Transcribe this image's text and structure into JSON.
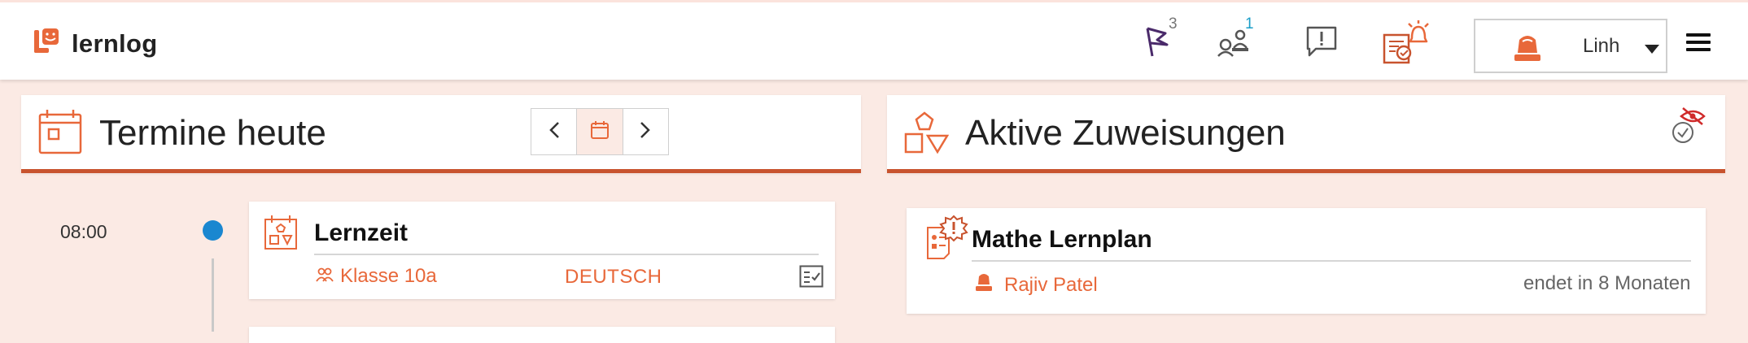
{
  "app": {
    "name": "lernlog"
  },
  "header": {
    "flag_badge": "3",
    "support_badge": "1",
    "user_name": "Linh"
  },
  "schedule": {
    "title": "Termine heute",
    "entries": [
      {
        "time": "08:00",
        "title": "Lernzeit",
        "group": "Klasse 10a",
        "subject": "DEUTSCH"
      }
    ]
  },
  "assignments": {
    "title": "Aktive Zuweisungen",
    "items": [
      {
        "title": "Mathe Lernplan",
        "person": "Rajiv Patel",
        "due": "endet in 8 Monaten"
      }
    ]
  },
  "colors": {
    "accent": "#e8683a",
    "accent_dark": "#c8532e",
    "timeline_dot": "#1a87d0",
    "flag": "#4a2a6a",
    "support_badge": "#1a9ec8",
    "background": "#fbeae4"
  },
  "icons": {
    "logo": "lernlog-logo-icon",
    "flag": "flag-icon",
    "support": "support-agent-icon",
    "feedback": "feedback-icon",
    "tasks": "task-alarm-icon",
    "avatar": "user-avatar-icon",
    "dropdown": "caret-down-icon",
    "menu": "menu-icon",
    "calendar": "calendar-icon",
    "shapes": "shapes-icon",
    "hidden": "eye-off-check-icon",
    "group": "group-icon",
    "checklist": "checklist-icon",
    "person": "person-icon",
    "plan_alert": "plan-alert-icon"
  }
}
